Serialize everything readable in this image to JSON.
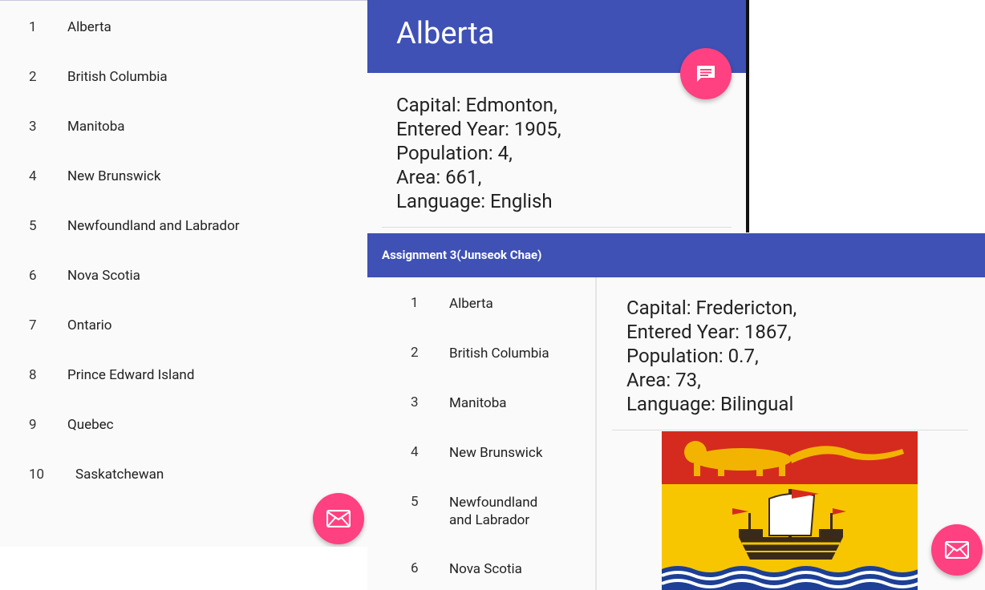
{
  "list_panel": {
    "items": [
      {
        "num": "1",
        "name": "Alberta"
      },
      {
        "num": "2",
        "name": "British Columbia"
      },
      {
        "num": "3",
        "name": "Manitoba"
      },
      {
        "num": "4",
        "name": "New Brunswick"
      },
      {
        "num": "5",
        "name": "Newfoundland and Labrador"
      },
      {
        "num": "6",
        "name": "Nova Scotia"
      },
      {
        "num": "7",
        "name": "Ontario"
      },
      {
        "num": "8",
        "name": "Prince Edward Island"
      },
      {
        "num": "9",
        "name": "Quebec"
      },
      {
        "num": "10",
        "name": "Saskatchewan"
      }
    ],
    "fab_icon": "email-icon"
  },
  "detail_panel": {
    "title": "Alberta",
    "fab_icon": "message-icon",
    "info": [
      "Capital: Edmonton,",
      "Entered Year: 1905,",
      "Population: 4,",
      "Area: 661,",
      "Language: English"
    ]
  },
  "tablet_panel": {
    "app_title": "Assignment 3(Junseok Chae)",
    "items": [
      {
        "num": "1",
        "name": "Alberta"
      },
      {
        "num": "2",
        "name": "British Columbia"
      },
      {
        "num": "3",
        "name": "Manitoba"
      },
      {
        "num": "4",
        "name": "New Brunswick"
      },
      {
        "num": "5",
        "name": "Newfoundland\nand Labrador"
      },
      {
        "num": "6",
        "name": "Nova Scotia"
      }
    ],
    "info": [
      "Capital: Fredericton,",
      "Entered Year: 1867,",
      "Population: 0.7,",
      "Area: 73,",
      "Language: Bilingual"
    ],
    "flag_icon": "new-brunswick-flag",
    "fab_icon": "email-icon"
  },
  "colors": {
    "primary": "#3f51b5",
    "accent": "#ff4081",
    "background": "#fafafa"
  }
}
